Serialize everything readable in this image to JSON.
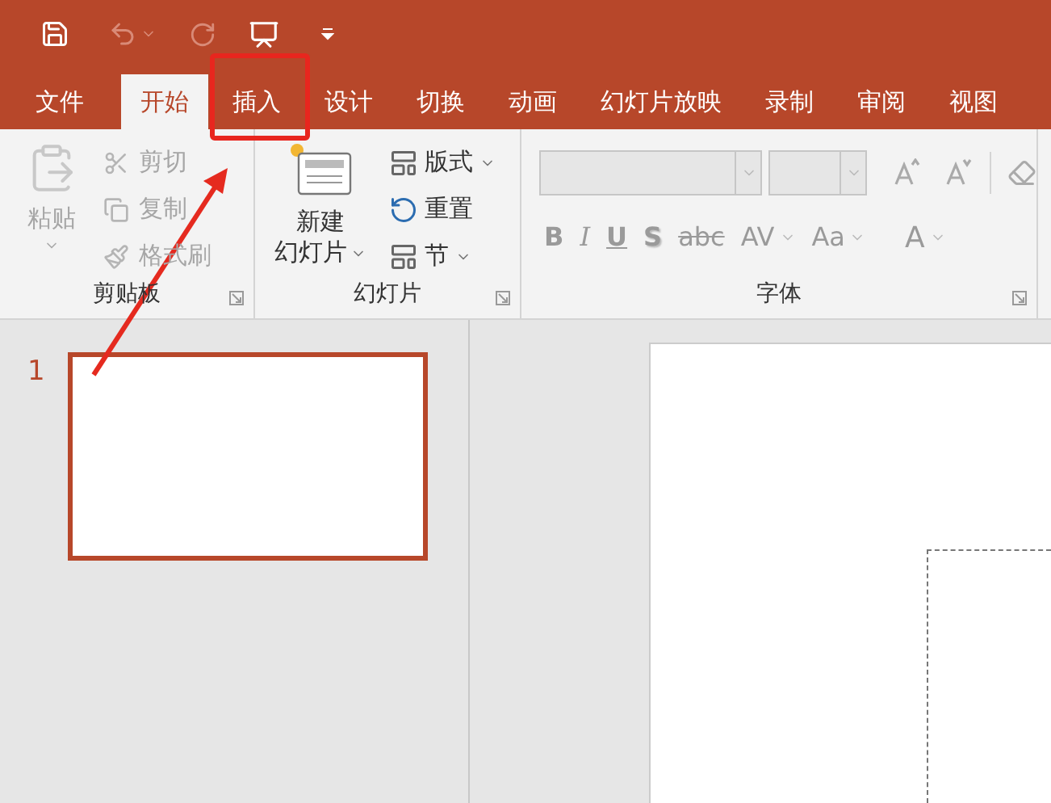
{
  "tabs": [
    {
      "label": "文件",
      "selected": false
    },
    {
      "label": "开始",
      "selected": true
    },
    {
      "label": "插入",
      "selected": false
    },
    {
      "label": "设计",
      "selected": false
    },
    {
      "label": "切换",
      "selected": false
    },
    {
      "label": "动画",
      "selected": false
    },
    {
      "label": "幻灯片放映",
      "selected": false
    },
    {
      "label": "录制",
      "selected": false
    },
    {
      "label": "审阅",
      "selected": false
    },
    {
      "label": "视图",
      "selected": false
    }
  ],
  "clipboard": {
    "label": "剪贴板",
    "paste": {
      "label": "粘贴",
      "disabled": true
    },
    "commands": [
      {
        "label": "剪切",
        "kind": "cut",
        "disabled": true
      },
      {
        "label": "复制",
        "kind": "copy",
        "disabled": true
      },
      {
        "label": "格式刷",
        "kind": "painter",
        "disabled": true
      }
    ]
  },
  "slides": {
    "label": "幻灯片",
    "new_slide": {
      "label_line1": "新建",
      "label_line2": "幻灯片"
    },
    "commands": [
      {
        "label": "版式",
        "kind": "layout",
        "dropdown": true
      },
      {
        "label": "重置",
        "kind": "reset",
        "dropdown": false
      },
      {
        "label": "节",
        "kind": "section",
        "dropdown": true
      }
    ]
  },
  "font": {
    "label": "字体",
    "disabled": true,
    "format_buttons": [
      {
        "label": "B",
        "kind": "bold",
        "dropdown": false
      },
      {
        "label": "I",
        "kind": "italic",
        "dropdown": false
      },
      {
        "label": "U",
        "kind": "underline",
        "dropdown": false
      },
      {
        "label": "S",
        "kind": "shadow",
        "dropdown": false
      },
      {
        "label": "abc",
        "kind": "strike",
        "dropdown": false
      },
      {
        "label": "AV",
        "kind": "spacing",
        "dropdown": true
      },
      {
        "label": "Aa",
        "kind": "case",
        "dropdown": true
      },
      {
        "label": "A",
        "kind": "color",
        "dropdown": true
      }
    ]
  },
  "slide_panel": {
    "slides": [
      {
        "number": "1",
        "selected": true
      }
    ]
  }
}
